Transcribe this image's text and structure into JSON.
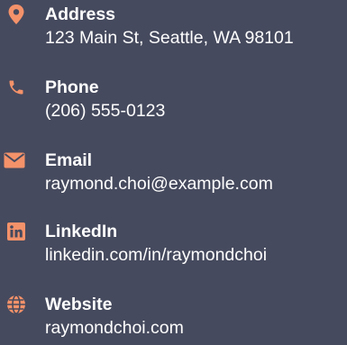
{
  "colors": {
    "background": "#464a5e",
    "accent": "#f4926a",
    "text": "#ffffff"
  },
  "contacts": [
    {
      "icon": "map-marker-icon",
      "label": "Address",
      "value": "123 Main St, Seattle, WA 98101"
    },
    {
      "icon": "phone-icon",
      "label": "Phone",
      "value": "(206) 555-0123"
    },
    {
      "icon": "envelope-icon",
      "label": "Email",
      "value": "raymond.choi@example.com"
    },
    {
      "icon": "linkedin-icon",
      "label": "LinkedIn",
      "value": "linkedin.com/in/raymondchoi"
    },
    {
      "icon": "globe-icon",
      "label": "Website",
      "value": "raymondchoi.com"
    }
  ]
}
